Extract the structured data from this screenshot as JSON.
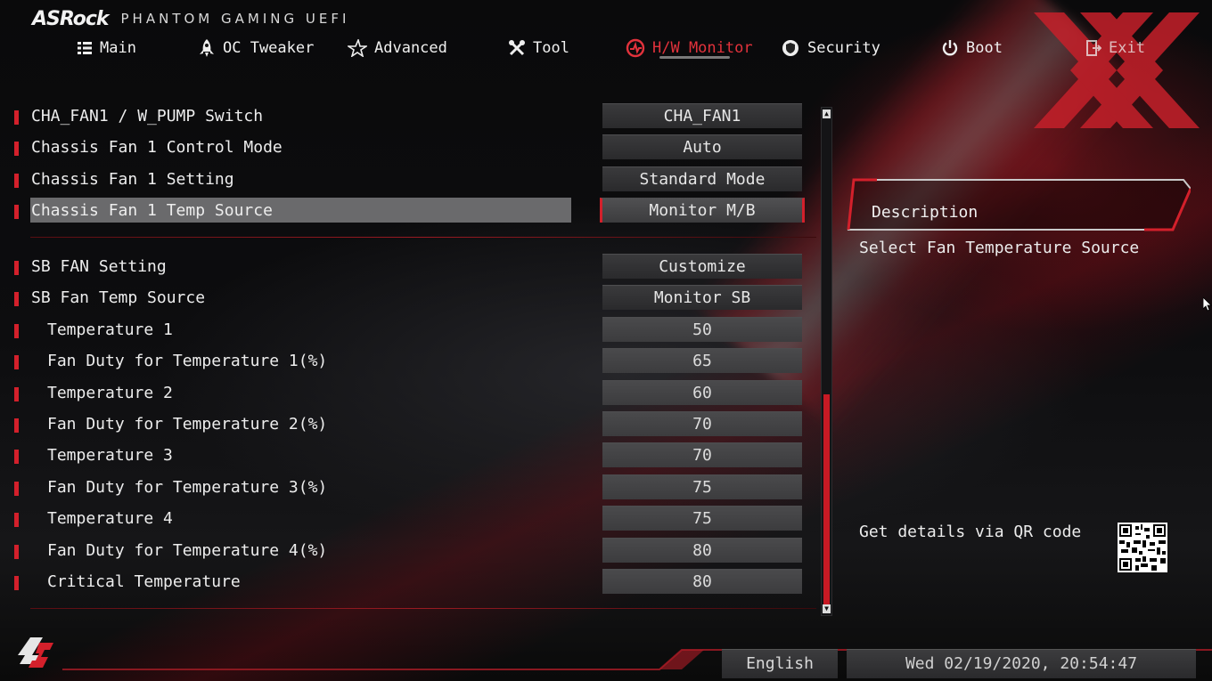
{
  "brand": {
    "logo": "ASRock",
    "product": "PHANTOM GAMING UEFI"
  },
  "nav": [
    {
      "label": "Main",
      "icon": "list-icon"
    },
    {
      "label": "OC Tweaker",
      "icon": "rocket-icon"
    },
    {
      "label": "Advanced",
      "icon": "star-icon"
    },
    {
      "label": "Tool",
      "icon": "tools-icon"
    },
    {
      "label": "H/W Monitor",
      "icon": "monitor-gauge-icon",
      "active": true
    },
    {
      "label": "Security",
      "icon": "shield-icon"
    },
    {
      "label": "Boot",
      "icon": "power-icon"
    },
    {
      "label": "Exit",
      "icon": "exit-door-icon"
    }
  ],
  "settings": [
    {
      "label": "CHA_FAN1 / W_PUMP Switch",
      "value": "CHA_FAN1"
    },
    {
      "label": "Chassis Fan 1 Control Mode",
      "value": "Auto"
    },
    {
      "label": "Chassis Fan 1 Setting",
      "value": "Standard Mode"
    },
    {
      "label": "Chassis Fan 1 Temp Source",
      "value": "Monitor M/B",
      "selected": true
    },
    {
      "label": "SB FAN Setting",
      "value": "Customize"
    },
    {
      "label": "SB Fan Temp Source",
      "value": "Monitor SB"
    },
    {
      "label": "Temperature 1",
      "value": "50"
    },
    {
      "label": "Fan Duty for Temperature 1(%)",
      "value": "65"
    },
    {
      "label": "Temperature 2",
      "value": "60"
    },
    {
      "label": "Fan Duty for Temperature 2(%)",
      "value": "70"
    },
    {
      "label": "Temperature 3",
      "value": "70"
    },
    {
      "label": "Fan Duty for Temperature 3(%)",
      "value": "75"
    },
    {
      "label": "Temperature 4",
      "value": "75"
    },
    {
      "label": "Fan Duty for Temperature 4(%)",
      "value": "80"
    },
    {
      "label": "Critical Temperature",
      "value": "80"
    }
  ],
  "description": {
    "title": "Description",
    "text": "Select Fan Temperature Source",
    "qr_text": "Get details via QR code"
  },
  "footer": {
    "language": "English",
    "datetime": "Wed 02/19/2020, 20:54:47"
  },
  "colors": {
    "accent": "#d3202b",
    "background": "#0b0b0c",
    "panel": "#3a3a3c"
  }
}
